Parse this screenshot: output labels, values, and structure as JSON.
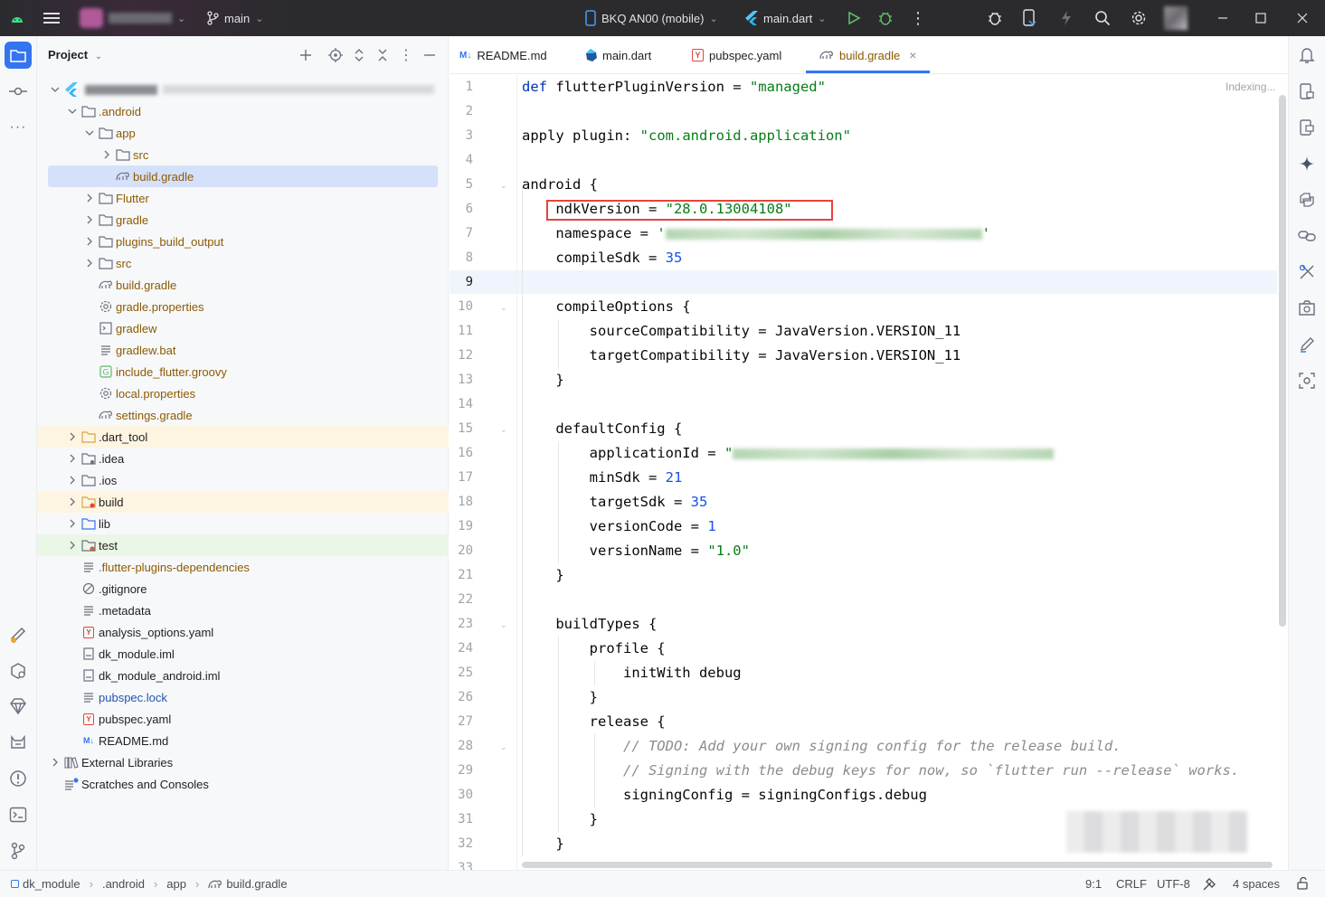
{
  "titlebar": {
    "branch": "main",
    "device": "BKQ AN00 (mobile)",
    "run_config": "main.dart"
  },
  "project_panel": {
    "title": "Project"
  },
  "tree": [
    {
      "label": ".android",
      "type": "folder",
      "depth": 1,
      "expanded": true,
      "color": "orange"
    },
    {
      "label": "app",
      "type": "folder",
      "depth": 2,
      "expanded": true,
      "color": "orange"
    },
    {
      "label": "src",
      "type": "folder",
      "depth": 3,
      "expanded": false,
      "color": "orange"
    },
    {
      "label": "build.gradle",
      "type": "gradle",
      "depth": 3,
      "selected": true,
      "color": "orange"
    },
    {
      "label": "Flutter",
      "type": "folder",
      "depth": 2,
      "expanded": false,
      "color": "orange"
    },
    {
      "label": "gradle",
      "type": "folder",
      "depth": 2,
      "expanded": false,
      "color": "orange"
    },
    {
      "label": "plugins_build_output",
      "type": "folder",
      "depth": 2,
      "expanded": false,
      "color": "orange"
    },
    {
      "label": "src",
      "type": "folder",
      "depth": 2,
      "expanded": false,
      "color": "orange"
    },
    {
      "label": "build.gradle",
      "type": "gradle",
      "depth": 2,
      "color": "orange"
    },
    {
      "label": "gradle.properties",
      "type": "settings",
      "depth": 2,
      "color": "orange"
    },
    {
      "label": "gradlew",
      "type": "terminal",
      "depth": 2,
      "color": "orange"
    },
    {
      "label": "gradlew.bat",
      "type": "text",
      "depth": 2,
      "color": "orange"
    },
    {
      "label": "include_flutter.groovy",
      "type": "groovy",
      "depth": 2,
      "color": "orange"
    },
    {
      "label": "local.properties",
      "type": "settings",
      "depth": 2,
      "color": "orange"
    },
    {
      "label": "settings.gradle",
      "type": "gradle",
      "depth": 2,
      "color": "orange"
    },
    {
      "label": ".dart_tool",
      "type": "folder-orange",
      "depth": 1,
      "expanded": false,
      "color": "dark",
      "bg": "yellow"
    },
    {
      "label": ".idea",
      "type": "folder-dot",
      "depth": 1,
      "expanded": false,
      "color": "dark"
    },
    {
      "label": ".ios",
      "type": "folder",
      "depth": 1,
      "expanded": false,
      "color": "dark"
    },
    {
      "label": "build",
      "type": "folder-orange-dot",
      "depth": 1,
      "expanded": false,
      "color": "dark",
      "bg": "yellow"
    },
    {
      "label": "lib",
      "type": "folder-blue",
      "depth": 1,
      "expanded": false,
      "color": "dark"
    },
    {
      "label": "test",
      "type": "folder-green-dot",
      "depth": 1,
      "expanded": false,
      "color": "dark",
      "bg": "green"
    },
    {
      "label": ".flutter-plugins-dependencies",
      "type": "text",
      "depth": 1,
      "color": "orange"
    },
    {
      "label": ".gitignore",
      "type": "ignore",
      "depth": 1,
      "color": "dark"
    },
    {
      "label": ".metadata",
      "type": "text",
      "depth": 1,
      "color": "dark"
    },
    {
      "label": "analysis_options.yaml",
      "type": "yaml",
      "depth": 1,
      "color": "dark"
    },
    {
      "label": "dk_module.iml",
      "type": "iml",
      "depth": 1,
      "color": "dark"
    },
    {
      "label": "dk_module_android.iml",
      "type": "iml",
      "depth": 1,
      "color": "dark"
    },
    {
      "label": "pubspec.lock",
      "type": "text",
      "depth": 1,
      "color": "blue"
    },
    {
      "label": "pubspec.yaml",
      "type": "yaml",
      "depth": 1,
      "color": "dark"
    },
    {
      "label": "README.md",
      "type": "md",
      "depth": 1,
      "color": "dark"
    },
    {
      "label": "External Libraries",
      "type": "libs",
      "depth": 0,
      "expanded": false,
      "color": "dark"
    },
    {
      "label": "Scratches and Consoles",
      "type": "scratch",
      "depth": 0,
      "color": "dark"
    }
  ],
  "tabs": [
    {
      "label": "README.md",
      "icon": "markdown-icon",
      "active": false
    },
    {
      "label": "main.dart",
      "icon": "dart-icon",
      "active": false
    },
    {
      "label": "pubspec.yaml",
      "icon": "yaml-icon",
      "active": false
    },
    {
      "label": "build.gradle",
      "icon": "gradle-icon",
      "active": true,
      "close": "×"
    }
  ],
  "editor": {
    "indexing": "Indexing...",
    "lines": [
      "1",
      "2",
      "3",
      "4",
      "5",
      "6",
      "7",
      "8",
      "9",
      "10",
      "11",
      "12",
      "13",
      "14",
      "15",
      "16",
      "17",
      "18",
      "19",
      "20",
      "21",
      "22",
      "23",
      "24",
      "25",
      "26",
      "27",
      "28",
      "29",
      "30",
      "31",
      "32",
      "33"
    ],
    "code": {
      "l1_kw": "def",
      "l1_rest": " flutterPluginVersion = ",
      "l1_str": "\"managed\"",
      "l3_rest": "apply plugin: ",
      "l3_str": "\"com.android.application\"",
      "l5": "android {",
      "l6_rest": "    ndkVersion = ",
      "l6_str": "\"28.0.13004108\"",
      "l7_rest": "    namespace = ",
      "l7_str": "'",
      "l8_rest": "    compileSdk = ",
      "l8_num": "35",
      "l10": "    compileOptions {",
      "l11": "        sourceCompatibility = JavaVersion.VERSION_11",
      "l12": "        targetCompatibility = JavaVersion.VERSION_11",
      "l13": "    }",
      "l15": "    defaultConfig {",
      "l16_rest": "        applicationId = ",
      "l16_str": "\"",
      "l17_rest": "        minSdk = ",
      "l17_num": "21",
      "l18_rest": "        targetSdk = ",
      "l18_num": "35",
      "l19_rest": "        versionCode = ",
      "l19_num": "1",
      "l20_rest": "        versionName = ",
      "l20_str": "\"1.0\"",
      "l21": "    }",
      "l23": "    buildTypes {",
      "l24": "        profile {",
      "l25": "            initWith debug",
      "l26": "        }",
      "l27": "        release {",
      "l28": "            // TODO: Add your own signing config for the release build.",
      "l29": "            // Signing with the debug keys for now, so `flutter run --release` works.",
      "l30": "            signingConfig = signingConfigs.debug",
      "l31": "        }",
      "l32": "    }"
    },
    "highlight_color": "#e5443b"
  },
  "statusbar": {
    "breadcrumb": [
      "dk_module",
      ".android",
      "app",
      "build.gradle"
    ],
    "position": "9:1",
    "line_sep": "CRLF",
    "encoding": "UTF-8",
    "indent": "4 spaces"
  },
  "colors": {
    "accent": "#3574f0",
    "string": "#067d17",
    "keyword": "#0033b3",
    "number": "#1750eb"
  }
}
